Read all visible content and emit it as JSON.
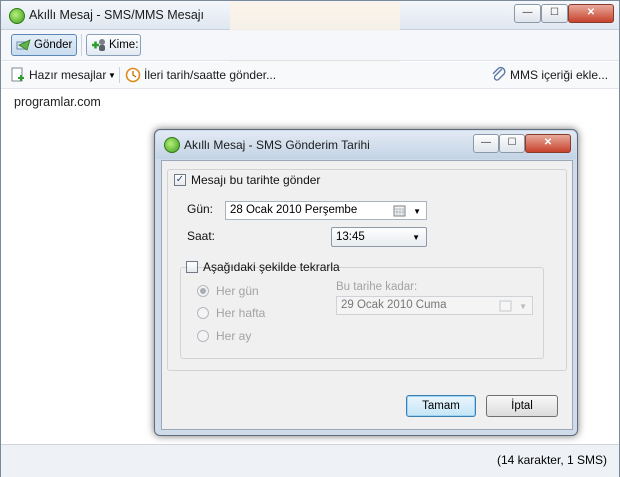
{
  "window": {
    "title": "Akıllı Mesaj - SMS/MMS Mesajı",
    "controls": {
      "minimize": "—",
      "maximize": "☐",
      "close": "✕"
    }
  },
  "toolbar": {
    "send_label": "Gönder",
    "to_label": "Kime:"
  },
  "actions": {
    "ready_messages": "Hazır mesajlar",
    "schedule": "İleri tarih/saatte gönder...",
    "mms_content": "MMS içeriği ekle..."
  },
  "message": {
    "text": "programlar.com"
  },
  "status": {
    "counter": "(14 karakter, 1 SMS)"
  },
  "dialog": {
    "title": "Akıllı Mesaj - SMS Gönderim Tarihi",
    "send_on_date": {
      "label": "Mesajı bu tarihte gönder",
      "checked": true
    },
    "day_label": "Gün:",
    "date_value": "28   Ocak   2010 Perşembe",
    "time_label": "Saat:",
    "time_value": "13:45",
    "repeat": {
      "label": "Aşağıdaki şekilde tekrarla",
      "checked": false
    },
    "repeat_options": [
      {
        "label": "Her gün",
        "selected": true
      },
      {
        "label": "Her hafta",
        "selected": false
      },
      {
        "label": "Her ay",
        "selected": false
      }
    ],
    "until_label": "Bu tarihe kadar:",
    "until_value": "29   Ocak   2010    Cuma",
    "ok_label": "Tamam",
    "cancel_label": "İptal"
  },
  "colors": {
    "accent": "#3c7fb1",
    "title_bg": "#dfe7f0",
    "dialog_frame": "#cfdbe8"
  },
  "icons": [
    "app-icon",
    "send-icon",
    "add-contact-icon",
    "document-add-icon",
    "clock-icon",
    "paperclip-icon",
    "calendar-icon",
    "chevron-down-icon"
  ]
}
